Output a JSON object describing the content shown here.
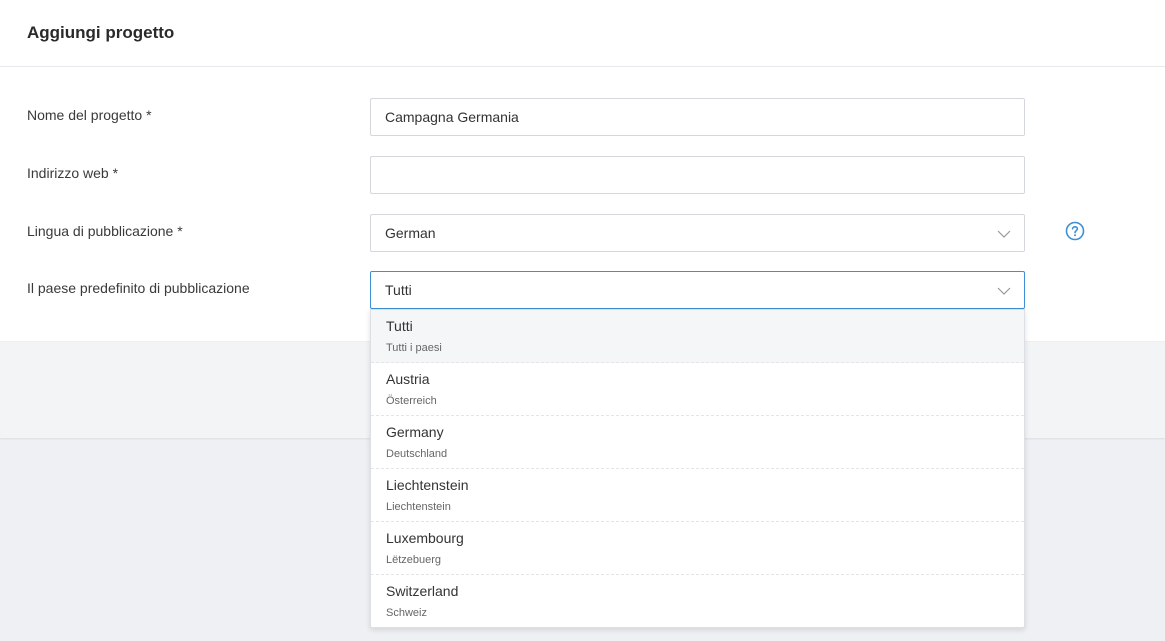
{
  "header": {
    "title": "Aggiungi progetto"
  },
  "form": {
    "project_name": {
      "label": "Nome del progetto *",
      "value": "Campagna Germania"
    },
    "web_address": {
      "label": "Indirizzo web *",
      "value": ""
    },
    "language": {
      "label": "Lingua di pubblicazione *",
      "value": "German"
    },
    "country": {
      "label": "Il paese predefinito di pubblicazione",
      "value": "Tutti"
    }
  },
  "dropdown": {
    "options": [
      {
        "name": "Tutti",
        "sub": "Tutti i paesi"
      },
      {
        "name": "Austria",
        "sub": "Österreich"
      },
      {
        "name": "Germany",
        "sub": "Deutschland"
      },
      {
        "name": "Liechtenstein",
        "sub": "Liechtenstein"
      },
      {
        "name": "Luxembourg",
        "sub": "Lëtzebuerg"
      },
      {
        "name": "Switzerland",
        "sub": "Schweiz"
      }
    ]
  },
  "icons": {
    "help": "help-circle-icon",
    "chevron": "chevron-down-icon"
  },
  "colors": {
    "accent": "#3e8fd6"
  }
}
